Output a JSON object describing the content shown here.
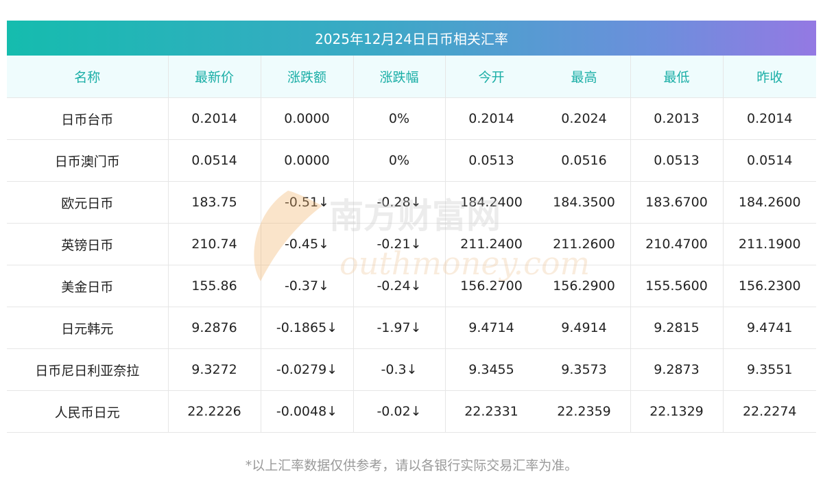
{
  "title": "2025年12月24日日币相关汇率",
  "columns": [
    "名称",
    "最新价",
    "涨跌额",
    "涨跌幅",
    "今开",
    "最高",
    "最低",
    "昨收"
  ],
  "rows": [
    {
      "name": "日币台币",
      "latest": "0.2014",
      "change": "0.0000",
      "pct": "0%",
      "open": "0.2014",
      "high": "0.2024",
      "low": "0.2013",
      "prev": "0.2014",
      "trend": "flat"
    },
    {
      "name": "日币澳门币",
      "latest": "0.0514",
      "change": "0.0000",
      "pct": "0%",
      "open": "0.0513",
      "high": "0.0516",
      "low": "0.0513",
      "prev": "0.0514",
      "trend": "flat"
    },
    {
      "name": "欧元日币",
      "latest": "183.75",
      "change": "-0.51↓",
      "pct": "-0.28↓",
      "open": "184.2400",
      "high": "184.3500",
      "low": "183.6700",
      "prev": "184.2600",
      "trend": "down"
    },
    {
      "name": "英镑日币",
      "latest": "210.74",
      "change": "-0.45↓",
      "pct": "-0.21↓",
      "open": "211.2400",
      "high": "211.2600",
      "low": "210.4700",
      "prev": "211.1900",
      "trend": "down"
    },
    {
      "name": "美金日币",
      "latest": "155.86",
      "change": "-0.37↓",
      "pct": "-0.24↓",
      "open": "156.2700",
      "high": "156.2900",
      "low": "155.5600",
      "prev": "156.2300",
      "trend": "down"
    },
    {
      "name": "日元韩元",
      "latest": "9.2876",
      "change": "-0.1865↓",
      "pct": "-1.97↓",
      "open": "9.4714",
      "high": "9.4914",
      "low": "9.2815",
      "prev": "9.4741",
      "trend": "down"
    },
    {
      "name": "日币尼日利亚奈拉",
      "latest": "9.3272",
      "change": "-0.0279↓",
      "pct": "-0.3↓",
      "open": "9.3455",
      "high": "9.3573",
      "low": "9.2873",
      "prev": "9.3551",
      "trend": "down"
    },
    {
      "name": "人民币日元",
      "latest": "22.2226",
      "change": "-0.0048↓",
      "pct": "-0.02↓",
      "open": "22.2331",
      "high": "22.2359",
      "low": "22.1329",
      "prev": "22.2274",
      "trend": "down"
    }
  ],
  "footnote": "*以上汇率数据仅供参考，请以各银行实际交易汇率为准。",
  "watermark": {
    "cn": "南方财富网",
    "en": "outhmoney.com"
  },
  "colors": {
    "header_text": "#1aaea6",
    "down": "#1a8c1a",
    "title_gradient_start": "#15bcae",
    "title_gradient_end": "#9479e3"
  }
}
